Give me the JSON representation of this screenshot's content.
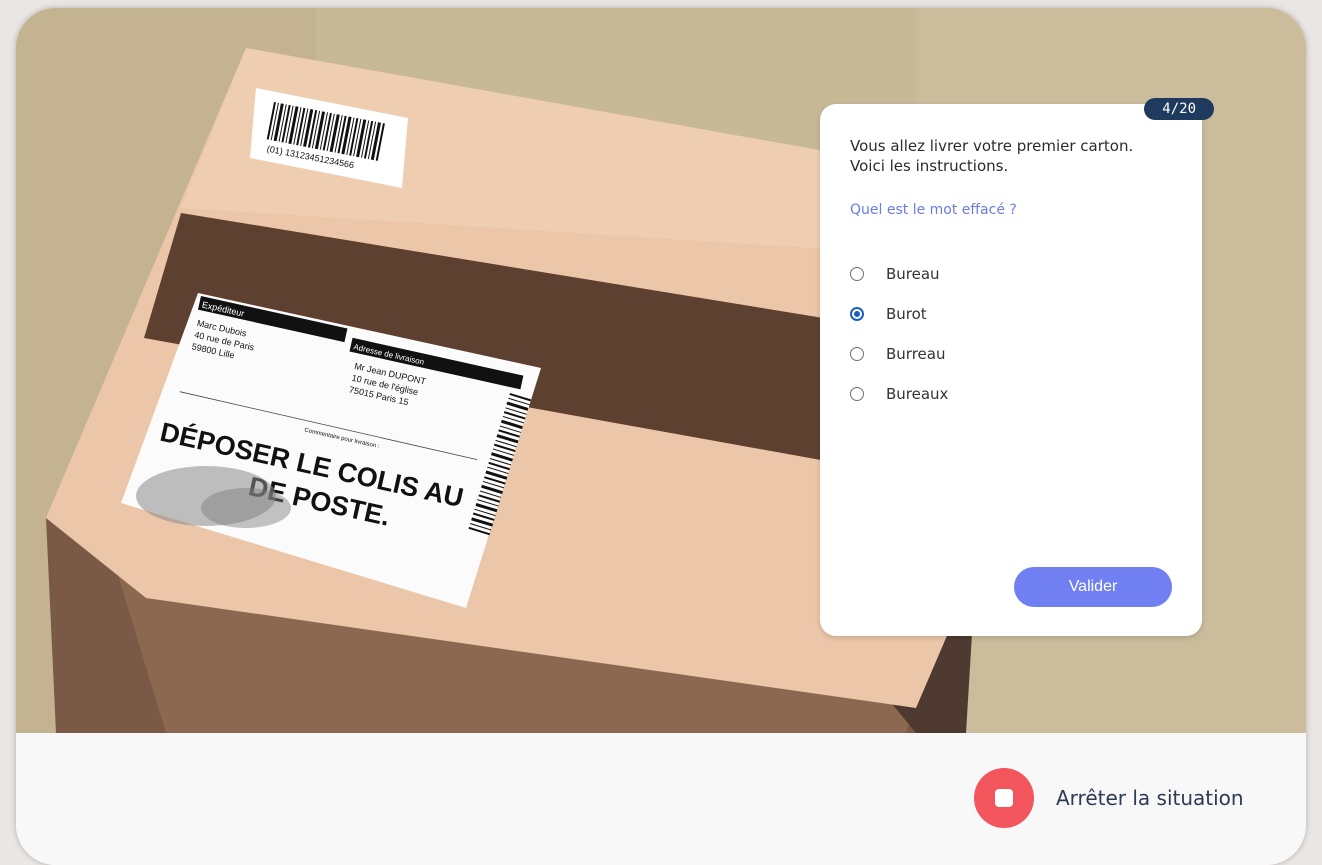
{
  "counter": "4/20",
  "intro": "Vous allez livrer votre premier carton. Voici les instructions.",
  "question": "Quel est le mot effacé ?",
  "options": [
    {
      "label": "Bureau",
      "selected": false
    },
    {
      "label": "Burot",
      "selected": true
    },
    {
      "label": "Burreau",
      "selected": false
    },
    {
      "label": "Bureaux",
      "selected": false
    }
  ],
  "validate_label": "Valider",
  "stop_label": "Arrêter la situation",
  "package": {
    "barcode_number": "(01) 13123451234566",
    "sender_header": "Expéditeur",
    "sender_lines": [
      "Marc Dubois",
      "40 rue de Paris",
      "59800 Lille"
    ],
    "recipient_header": "Adresse de livraison",
    "recipient_lines": [
      "Mr Jean DUPONT",
      "10 rue de l'église",
      "75015 Paris 15"
    ],
    "comment_header": "Commentaire pour livraison :",
    "instruction_line1": "DÉPOSER LE COLIS AU",
    "instruction_line2": "DE POSTE."
  },
  "colors": {
    "accent": "#7080f3",
    "counter_bg": "#1f3a5f",
    "stop": "#f2565c",
    "radio_checked": "#1a5fc8"
  }
}
